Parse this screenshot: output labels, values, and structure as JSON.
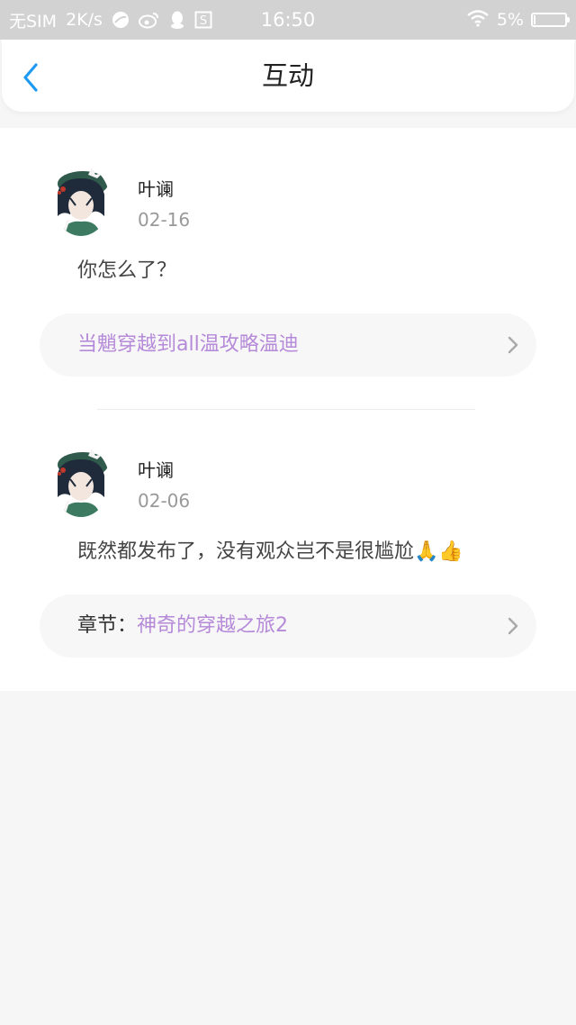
{
  "status_bar": {
    "carrier": "无SIM",
    "speed": "2K/s",
    "time": "16:50",
    "battery_percent": "5%",
    "battery_level": 0.05,
    "icons": [
      "browser-icon",
      "weibo-icon",
      "qq-icon",
      "s-app-icon",
      "wifi-icon",
      "battery-icon"
    ]
  },
  "header": {
    "title": "互动",
    "back_icon": "chevron-left-icon"
  },
  "colors": {
    "accent_blue": "#1e9af3",
    "link_purple": "#b58ad8",
    "status_bar_bg": "#d2d2d2"
  },
  "comments": [
    {
      "user": "叶谰",
      "date": "02-16",
      "text": "你怎么了？",
      "ref_prefix": "",
      "ref_title": "当魈穿越到all温攻略温迪"
    },
    {
      "user": "叶谰",
      "date": "02-06",
      "text": "既然都发布了，没有观众岂不是很尴尬🙏👍",
      "ref_prefix": "章节：",
      "ref_title": "神奇的穿越之旅2"
    }
  ]
}
